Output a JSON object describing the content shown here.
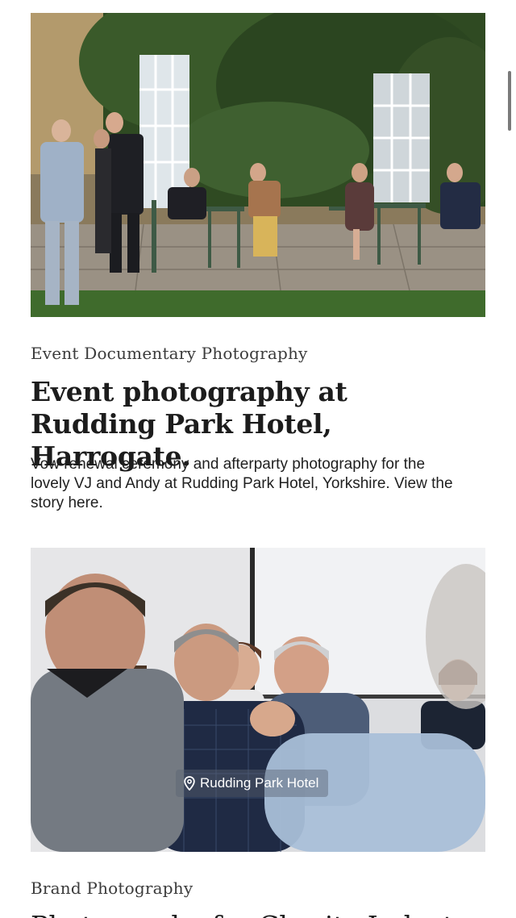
{
  "posts": [
    {
      "photo_alt": "Guests on a terrace in front of an ivy-covered hotel wall",
      "category": "Event Documentary Photography",
      "title": "Event photography at Rudding Park Hotel, Harrogate.",
      "excerpt": "Vow renewal ceremony and afterparty photography for the lovely VJ and Andy at Rudding Park Hotel, Yorkshire. View the story here."
    },
    {
      "photo_alt": "People seated in a meeting room discussing",
      "location_tag": "Rudding Park Hotel",
      "location_icon": "map-pin-icon",
      "category": "Brand Photography",
      "title_partial": "Photography for Charity Industry"
    }
  ],
  "colors": {
    "text_primary": "#1c1c1c",
    "text_category": "#3b3b3b",
    "background": "#ffffff",
    "scrollbar": "#7a7a7a"
  }
}
